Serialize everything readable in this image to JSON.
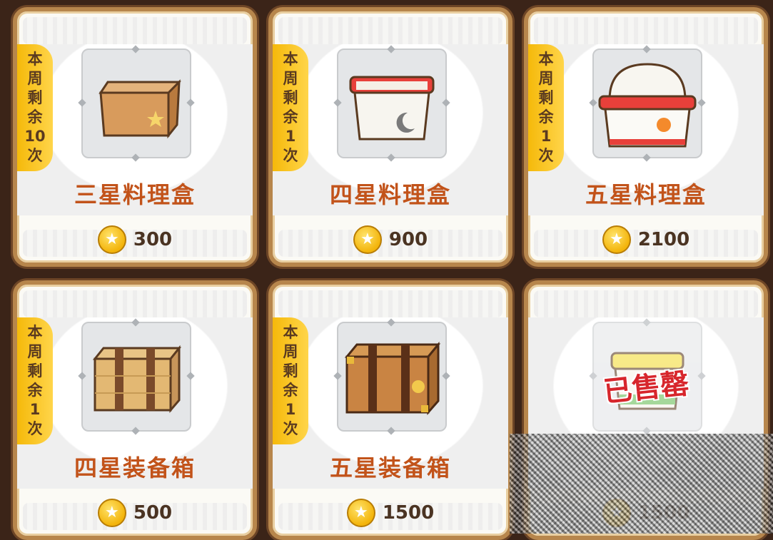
{
  "shop_items": [
    {
      "name": "三星料理盒",
      "limit_tag": [
        "本",
        "周",
        "剩",
        "余",
        "10",
        "次"
      ],
      "price": "300",
      "icon": "cardboard-box-icon",
      "sold_out": false
    },
    {
      "name": "四星料理盒",
      "limit_tag": [
        "本",
        "周",
        "剩",
        "余",
        "1",
        "次"
      ],
      "price": "900",
      "icon": "red-lunchbox-icon",
      "sold_out": false
    },
    {
      "name": "五星料理盒",
      "limit_tag": [
        "本",
        "周",
        "剩",
        "余",
        "1",
        "次"
      ],
      "price": "2100",
      "icon": "deluxe-lunchbox-icon",
      "sold_out": false
    },
    {
      "name": "四星装备箱",
      "limit_tag": [
        "本",
        "周",
        "剩",
        "余",
        "1",
        "次"
      ],
      "price": "500",
      "icon": "wooden-crate-icon",
      "sold_out": false
    },
    {
      "name": "五星装备箱",
      "limit_tag": [
        "本",
        "周",
        "剩",
        "余",
        "1",
        "次"
      ],
      "price": "1500",
      "icon": "reinforced-crate-icon",
      "sold_out": false
    },
    {
      "name": "",
      "limit_tag": [],
      "price": "1500",
      "icon": "yellow-lunchbox-icon",
      "sold_out": true,
      "sold_out_label": "已售罄"
    }
  ],
  "colors": {
    "background": "#3b2418",
    "card_border": "#b7864c",
    "tag": "#f5b90a",
    "name_text": "#c2531a",
    "sold_out_text": "#d7262c"
  },
  "currency_icon": "star-coin-icon"
}
